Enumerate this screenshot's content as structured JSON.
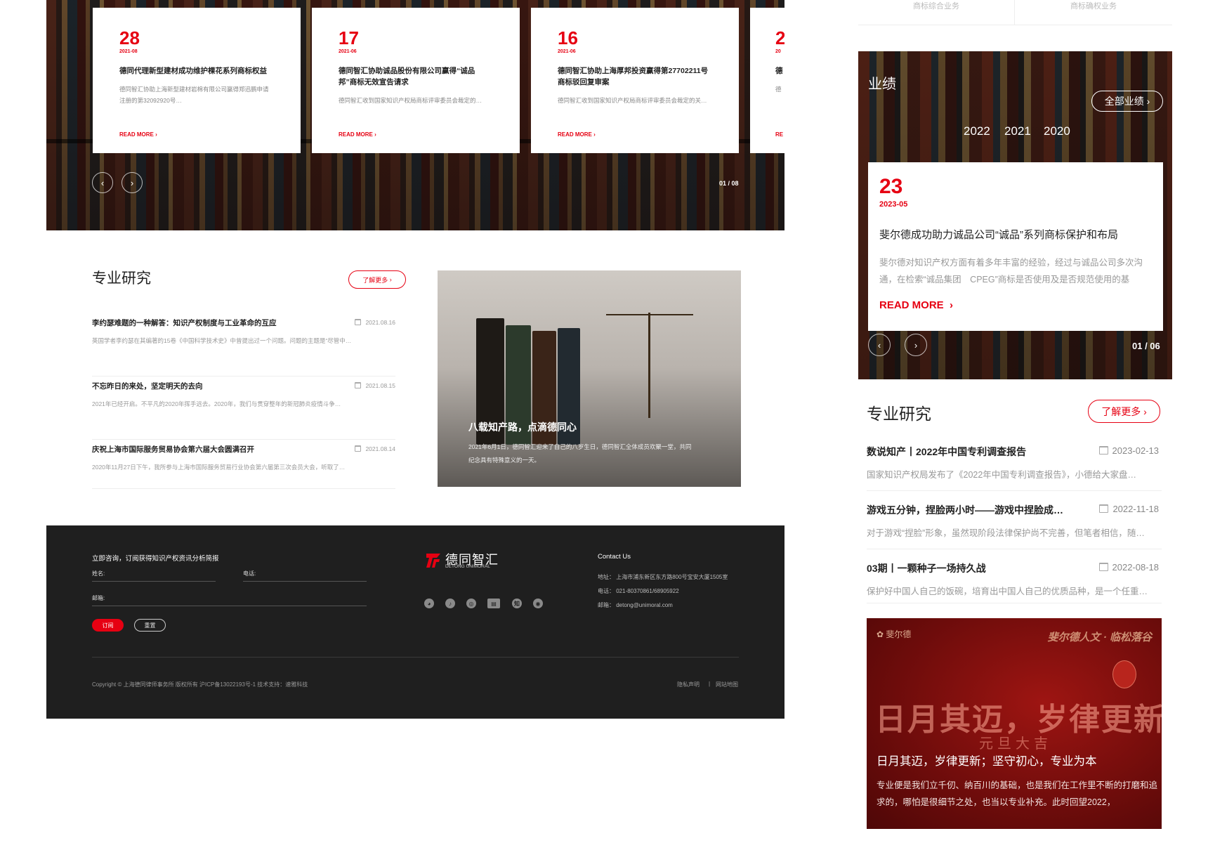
{
  "desktop": {
    "hero_cards": [
      {
        "day": "28",
        "ym": "2021-08",
        "title": "德同代理新型建材成功维护棵花系列商标权益",
        "desc": "德同智汇协助上海新型建材岩棉有限公司赢得郑迅鹏申请注册的第32092920号…",
        "more": "READ MORE"
      },
      {
        "day": "17",
        "ym": "2021-06",
        "title": "德同智汇协助诚品股份有限公司赢得“诚品邦”商标无效宣告请求",
        "desc": "德同智汇收到国家知识产权局商标评审委员会裁定的…",
        "more": "READ MORE"
      },
      {
        "day": "16",
        "ym": "2021-06",
        "title": "德同智汇协助上海厚邦投资赢得第27702211号商标驳回复审案",
        "desc": "德同智汇收到国家知识产权局商标评审委员会裁定的关…",
        "more": "READ MORE"
      },
      {
        "day": "2",
        "ym": "20",
        "title": "德",
        "desc": "德",
        "more": "RE"
      }
    ],
    "hero_pager": "01 / 08",
    "research": {
      "title": "专业研究",
      "more": "了解更多",
      "items": [
        {
          "title": "李约瑟难题的一种解答：知识产权制度与工业革命的互应",
          "date": "2021.08.16",
          "desc": "英国学者李约瑟在其编著的15卷《中国科学技术史》中曾提出过一个问题。问题的主题是“尽管中…"
        },
        {
          "title": "不忘昨日的来处，坚定明天的去向",
          "date": "2021.08.15",
          "desc": "2021年已经开启。不平凡的2020年挥手远去。2020年，我们与贯穿整年的新冠肺炎疫情斗争…"
        },
        {
          "title": "庆祝上海市国际服务贸易协会第六届大会圆满召开",
          "date": "2021.08.14",
          "desc": "2020年11月27日下午，我所参与上海市国际服务贸易行业协会第六届第三次会员大会，听取了…"
        }
      ],
      "feature": {
        "title": "八载知产路，点滴德同心",
        "desc": "2021年6月1日，德同智汇迎来了自己的八岁生日，德同智汇全体成员欢聚一堂，共同纪念具有特殊意义的一天。"
      }
    },
    "footer": {
      "subscribe_title": "立即咨询，订阅获得知识产权资讯分析简报",
      "name_label": "姓名:",
      "phone_label": "电话:",
      "email_label": "邮箱:",
      "subscribe_btn": "订阅",
      "reset_btn": "重置",
      "brand": "德同智汇",
      "brand_en": "DETONG UNIMORAL",
      "contact_title": "Contact Us",
      "address": "地址：  上海市浦东新区东方路800号宝安大厦1505室",
      "tel": "电话：  021-80370861/68905922",
      "email": "邮箱：  detong@unimoral.com",
      "copyright": "Copyright © 上海德同律师事务所 版权所有    沪ICP备13022193号-1      技术支持：速雅科技",
      "privacy": "隐私声明",
      "sitemap": "网站地图",
      "social_icons": [
        "wechat-icon",
        "tiktok-icon",
        "weibo-icon",
        "toutiao-icon",
        "zhihu-icon",
        "qq-icon"
      ]
    }
  },
  "mobile": {
    "tabs": [
      "商标综合业务",
      "商标确权业务"
    ],
    "performance": {
      "title": "业绩",
      "all": "全部业绩",
      "years": [
        "2022",
        "2021",
        "2020"
      ],
      "card": {
        "day": "23",
        "ym": "2023-05",
        "title": "斐尔德成功助力诚品公司“诚品”系列商标保护和布局",
        "desc": "斐尔德对知识产权方面有着多年丰富的经验，经过与诚品公司多次沟通，在检索“诚品集团　CPEG”商标是否使用及是否规范使用的基",
        "more": "READ MORE"
      },
      "pager": "01 / 06"
    },
    "research": {
      "title": "专业研究",
      "more": "了解更多",
      "items": [
        {
          "title": "数说知产丨2022年中国专利调查报告",
          "date": "2023-02-13",
          "desc": "国家知识产权局发布了《2022年中国专利调查报告》，小德给大家盘…"
        },
        {
          "title": "游戏五分钟，捏脸两小时——游戏中捏脸成…",
          "date": "2022-11-18",
          "desc": "对于游戏“捏脸”形象，虽然现阶段法律保护尚不完善，但笔者相信，随…"
        },
        {
          "title": "03期丨一颗种子一场持久战",
          "date": "2022-08-18",
          "desc": "保护好中国人自己的饭碗，培育出中国人自己的优质品种，是一个任重…"
        }
      ]
    },
    "banner": {
      "logo": "斐尔德",
      "slogan": "斐尔德人文 · 临松落谷",
      "big": "日月其迈，岁律更新",
      "sub": "元旦大吉",
      "title": "日月其迈，岁律更新；坚守初心，专业为本",
      "desc": "专业便是我们立千仞、纳百川的基础，也是我们在工作里不断的打磨和追求的，哪怕是很细节之处，也当以专业补充。此时回望2022，"
    }
  },
  "colors": {
    "accent": "#e60012",
    "footer_bg": "#1f1f1f"
  }
}
